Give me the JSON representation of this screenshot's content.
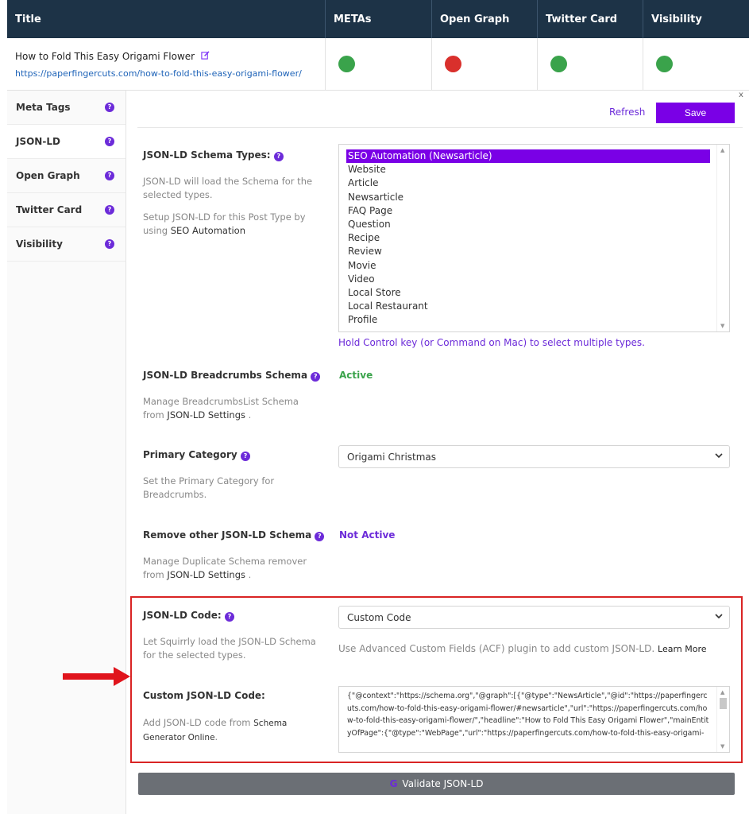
{
  "columns": [
    "Title",
    "METAs",
    "Open Graph",
    "Twitter Card",
    "Visibility"
  ],
  "post": {
    "title": "How to Fold This Easy Origami Flower",
    "url": "https://paperfingercuts.com/how-to-fold-this-easy-origami-flower/",
    "statuses": [
      {
        "name": "METAs",
        "color": "#3aa34b"
      },
      {
        "name": "Open Graph",
        "color": "#d9302c"
      },
      {
        "name": "Twitter Card",
        "color": "#3aa34b"
      },
      {
        "name": "Visibility",
        "color": "#3aa34b"
      }
    ]
  },
  "sidebar": [
    "Meta Tags",
    "JSON-LD",
    "Open Graph",
    "Twitter Card",
    "Visibility"
  ],
  "toolbar": {
    "refresh": "Refresh",
    "save": "Save",
    "close": "x"
  },
  "schema_types": {
    "label": "JSON-LD Schema Types:",
    "desc1": "JSON-LD will load the Schema for the selected types.",
    "desc2_prefix": "Setup JSON-LD for this Post Type by using",
    "desc2_link": "SEO Automation",
    "options": [
      "SEO Automation (Newsarticle)",
      "Website",
      "Article",
      "Newsarticle",
      "FAQ Page",
      "Question",
      "Recipe",
      "Review",
      "Movie",
      "Video",
      "Local Store",
      "Local Restaurant",
      "Profile"
    ],
    "hint": "Hold Control key (or Command on Mac) to select multiple types."
  },
  "breadcrumbs": {
    "label": "JSON-LD Breadcrumbs Schema",
    "desc_prefix": "Manage BreadcrumbsList Schema from",
    "desc_link": "JSON-LD Settings",
    "desc_suffix": ".",
    "status": "Active"
  },
  "primary_category": {
    "label": "Primary Category",
    "desc": "Set the Primary Category for Breadcrumbs.",
    "value": "Origami Christmas"
  },
  "remove_schema": {
    "label": "Remove other JSON-LD Schema",
    "desc_prefix": "Manage Duplicate Schema remover from",
    "desc_link": "JSON-LD Settings",
    "desc_suffix": ".",
    "status": "Not Active"
  },
  "jsonld_code": {
    "label": "JSON-LD Code:",
    "desc": "Let Squirrly load the JSON-LD Schema for the selected types.",
    "value": "Custom Code",
    "acf_text": "Use Advanced Custom Fields (ACF) plugin to add custom JSON-LD.",
    "learn_more": "Learn More"
  },
  "custom_code": {
    "label": "Custom JSON-LD Code:",
    "desc_prefix": "Add JSON-LD code from",
    "desc_link": "Schema Generator Online",
    "desc_suffix": ".",
    "code": "{\"@context\":\"https://schema.org\",\"@graph\":[{\"@type\":\"NewsArticle\",\"@id\":\"https://paperfingercuts.com/how-to-fold-this-easy-origami-flower/#newsarticle\",\"url\":\"https://paperfingercuts.com/how-to-fold-this-easy-origami-flower/\",\"headline\":\"How to Fold This Easy Origami Flower\",\"mainEntityOfPage\":{\"@type\":\"WebPage\",\"url\":\"https://paperfingercuts.com/how-to-fold-this-easy-origami-"
  },
  "validate": {
    "icon": "G",
    "label": "Validate JSON-LD"
  }
}
